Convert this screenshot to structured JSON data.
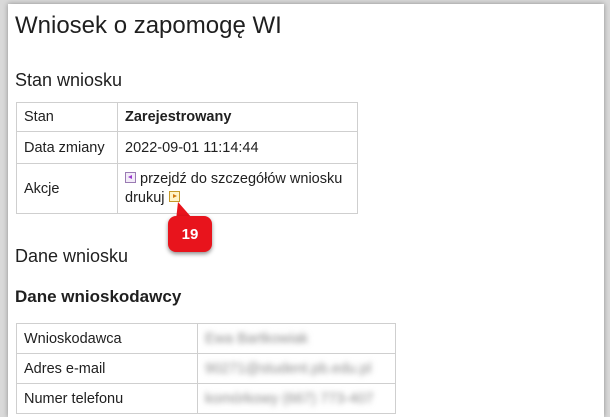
{
  "page_title": "Wniosek o zapomogę WI",
  "status_section": {
    "heading": "Stan wniosku",
    "rows": [
      {
        "label": "Stan",
        "value": "Zarejestrowany"
      },
      {
        "label": "Data zmiany",
        "value": "2022-09-01 11:14:44"
      },
      {
        "label": "Akcje",
        "link_details": "przejdź do szczegółów wniosku",
        "link_print": "drukuj"
      }
    ]
  },
  "application_heading": "Dane wniosku",
  "applicant_section": {
    "heading": "Dane wnioskodawcy",
    "rows": [
      {
        "label": "Wnioskodawca",
        "value": "Ewa Bartkowiak"
      },
      {
        "label": "Adres e-mail",
        "value": "90271@student.pb.edu.pl"
      },
      {
        "label": "Numer telefonu",
        "value": "komórkowy (667) 773-407"
      }
    ]
  },
  "annotation": {
    "badge_number": "19"
  },
  "colors": {
    "badge": "#e8141c",
    "border": "#cfcfcf",
    "backdrop": "#d9d9d9"
  }
}
